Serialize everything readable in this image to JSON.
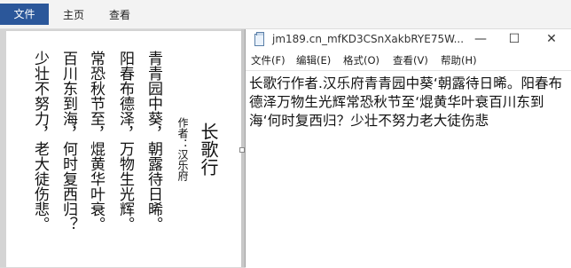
{
  "ribbon": {
    "tabs": [
      {
        "label": "文件",
        "active": true
      },
      {
        "label": "主页",
        "active": false
      },
      {
        "label": "查看",
        "active": false
      }
    ]
  },
  "document": {
    "title": "长歌行",
    "author": "作者：汉乐府",
    "lines": [
      "青青园中葵，朝露待日晞。",
      "阳春布德泽，万物生光辉。",
      "常恐秋节至，焜黄华叶衰。",
      "百川东到海，何时复西归？",
      "少壮不努力，老大徒伤悲。"
    ]
  },
  "notepad": {
    "title": "jm189.cn_mfKD3CSnXakbRYE75W...",
    "controls": {
      "minimize": "—",
      "maximize": "☐",
      "close": "✕"
    },
    "menu": [
      "文件(F)",
      "编辑(E)",
      "格式(O)",
      "查看(V)",
      "帮助(H)"
    ],
    "content": "长歌行作者.汉乐府青青园中葵‘朝露待日晞。阳春布德泽万物生光辉常恐秋节至‘焜黄华叶衰百川东到海‘何时复西归？少壮不努力老大徒伤悲"
  },
  "colors": {
    "ribbon_active": "#2b579a"
  }
}
